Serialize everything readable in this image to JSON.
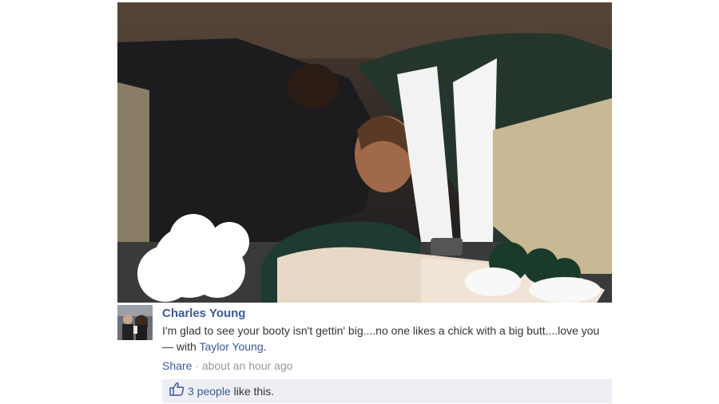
{
  "photo": {
    "description_icon": "photo"
  },
  "post": {
    "author": "Charles Young",
    "message_text": "I'm glad to see your booty isn't gettin' big....no one likes a chick with a big butt....love you",
    "with_prefix": " — with ",
    "tagged_person": "Taylor Young",
    "tagged_suffix": ".",
    "share_label": "Share",
    "separator": " · ",
    "timestamp": "about an hour ago"
  },
  "likes": {
    "icon": "thumbs-up-icon",
    "people_label": "3 people",
    "suffix": " like this."
  },
  "colors": {
    "link_blue": "#3b5998",
    "likes_bg": "#edeff4",
    "meta_gray": "#999999"
  }
}
